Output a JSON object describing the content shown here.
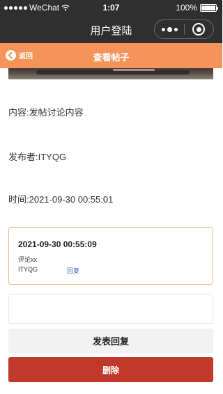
{
  "status_bar": {
    "carrier": "WeChat",
    "time": "1:07",
    "battery": "100%",
    "battery_level": 1.0
  },
  "nav_bar": {
    "title": "用户登陆"
  },
  "page_header": {
    "back_label": "返回",
    "title": "查看帖子"
  },
  "post": {
    "content": "内容:发帖讨论内容",
    "author": "发布者:ITYQG",
    "time": "时间:2021-09-30 00:55:01"
  },
  "comments": [
    {
      "time": "2021-09-30 00:55:09",
      "text": "评论xx",
      "author": "ITYQG",
      "reply_label": "回复"
    }
  ],
  "reply_form": {
    "value": "",
    "submit_label": "发表回复",
    "delete_label": "删除"
  },
  "colors": {
    "header_bg": "#f5935a",
    "status_bg": "#2f2f2f",
    "card_border": "#f0b889",
    "delete_bg": "#c0392b",
    "link": "#3b6dbf"
  },
  "icons": [
    "signal-dots-icon",
    "wifi-icon",
    "battery-icon",
    "more-dots-icon",
    "close-circle-icon",
    "back-arrow-icon"
  ]
}
